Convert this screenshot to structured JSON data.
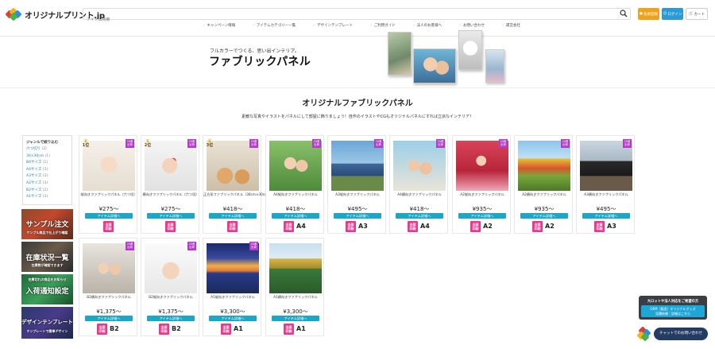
{
  "header": {
    "logo_text": "オリジナルプリント.jp",
    "search_placeholder": "アイテム検索",
    "member_label": "会員登録",
    "login_label": "ログイン",
    "cart_label": "カート",
    "nav": [
      "キャンペーン情報",
      "アイテムカテゴリー一覧",
      "デザインテンプレート",
      "ご利用ガイド",
      "法人のお客様へ",
      "お問い合わせ",
      "運営会社"
    ]
  },
  "hero": {
    "sub": "フルカラーでつくる、思い出インテリア。",
    "title": "ファブリックパネル"
  },
  "main": {
    "title": "オリジナルファブリックパネル",
    "desc": "素敵な写真やイラストをパネルにして部屋に飾りましょう！自作のイラストやCGもオリジナルパネルにすれば立派なインテリア！"
  },
  "sidebar": {
    "heading": "ジャンルで絞り込む",
    "items": [
      {
        "label": "六つ切り",
        "count": "(2)"
      },
      {
        "label": "30×30cm",
        "count": "(1)"
      },
      {
        "label": "B4サイズ",
        "count": "(1)"
      },
      {
        "label": "A4サイズ",
        "count": "(3)"
      },
      {
        "label": "A3サイズ",
        "count": "(3)"
      },
      {
        "label": "A2サイズ",
        "count": "(3)"
      },
      {
        "label": "B2サイズ",
        "count": "(2)"
      },
      {
        "label": "A1サイズ",
        "count": "(3)"
      }
    ],
    "banners": [
      {
        "text": "サンプル注文",
        "sub": "サンプル商品で仕上がり確認"
      },
      {
        "text": "在庫状況一覧",
        "sub": "在庫数が確認できます"
      },
      {
        "text": "入荷通知設定",
        "sub": "在庫切れの商品をお知らせ"
      },
      {
        "text": "デザインテンプレート",
        "sub": "テンプレートで簡単デザイン"
      }
    ]
  },
  "product_common": {
    "button_label": "アイテム詳細へ",
    "full_color_label": "全面\n印刷",
    "ship_badge": "20着\n出荷"
  },
  "products": [
    {
      "rank": "1位",
      "name": "縦向きファブリックパネル（六つ切）",
      "price": "¥275〜",
      "size": "",
      "ship": true
    },
    {
      "rank": "2位",
      "name": "横向きファブリックパネル（六つ切）",
      "price": "¥275〜",
      "size": "",
      "ship": true
    },
    {
      "rank": "3位",
      "name": "正方形ファブリックパネル（30cm×30cm）",
      "price": "¥418〜",
      "size": "",
      "ship": true
    },
    {
      "rank": "",
      "name": "A4縦向きファブリックパネル",
      "price": "¥418〜",
      "size": "A4",
      "ship": true
    },
    {
      "rank": "",
      "name": "A3縦向きファブリックパネル",
      "price": "¥495〜",
      "size": "A3",
      "ship": true
    },
    {
      "rank": "",
      "name": "A4横向きファブリックパネル",
      "price": "¥418〜",
      "size": "A4",
      "ship": true
    },
    {
      "rank": "",
      "name": "A2縦向きファブリックパネル",
      "price": "¥935〜",
      "size": "A2",
      "ship": true
    },
    {
      "rank": "",
      "name": "A2横向きファブリックパネル",
      "price": "¥935〜",
      "size": "A2",
      "ship": true
    },
    {
      "rank": "",
      "name": "A3横向きファブリックパネル",
      "price": "¥495〜",
      "size": "A3",
      "ship": true
    },
    {
      "rank": "",
      "name": "B2横向きファブリックパネル",
      "price": "¥1,375〜",
      "size": "B2",
      "ship": true
    },
    {
      "rank": "",
      "name": "B2縦向きファブリックパネル",
      "price": "¥1,375〜",
      "size": "B2",
      "ship": true
    },
    {
      "rank": "",
      "name": "A1縦向きファブリックパネル",
      "price": "¥3,300〜",
      "size": "A1",
      "ship": true
    },
    {
      "rank": "",
      "name": "A1横向きファブリックパネル",
      "price": "¥3,300〜",
      "size": "A1",
      "ship": false
    }
  ],
  "chat": {
    "title": "大ロットや法人対応をご希望の方",
    "link": "OEM（製造）オリジナルグッズ\n見積依頼｜詳細はこちら",
    "button": "チャットでのお問い合わせ"
  },
  "colors": {
    "accent_teal": "#1ba7c8",
    "badge_pink": "#e8398f",
    "badge_purple": "#b23cc6",
    "member_orange": "#f0a21a",
    "login_blue": "#2b9bd8"
  }
}
